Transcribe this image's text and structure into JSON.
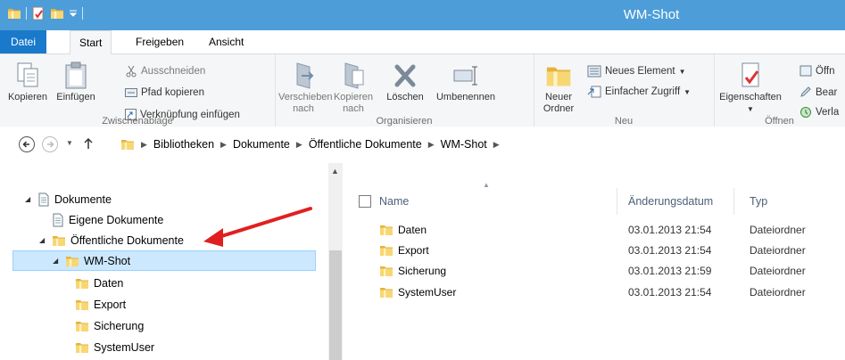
{
  "window": {
    "title": "WM-Shot"
  },
  "tabs": {
    "file": "Datei",
    "start": "Start",
    "share": "Freigeben",
    "view": "Ansicht"
  },
  "ribbon": {
    "clipboard": {
      "label": "Zwischenablage",
      "copy": "Kopieren",
      "paste": "Einfügen",
      "cut": "Ausschneiden",
      "copy_path": "Pfad kopieren",
      "paste_shortcut": "Verknüpfung einfügen"
    },
    "organize": {
      "label": "Organisieren",
      "move_to_line1": "Verschieben",
      "move_to_line2": "nach",
      "copy_to_line1": "Kopieren",
      "copy_to_line2": "nach",
      "delete": "Löschen",
      "rename": "Umbenennen"
    },
    "new": {
      "label": "Neu",
      "new_folder_line1": "Neuer",
      "new_folder_line2": "Ordner",
      "new_item": "Neues Element",
      "easy_access": "Einfacher Zugriff"
    },
    "open": {
      "label": "Öffnen",
      "properties": "Eigenschaften",
      "open": "Öffn",
      "edit": "Bear",
      "history": "Verla"
    }
  },
  "address": {
    "crumbs": [
      "Bibliotheken",
      "Dokumente",
      "Öffentliche Dokumente",
      "WM-Shot"
    ]
  },
  "nav_tree": {
    "items": [
      {
        "label": "Dokumente"
      },
      {
        "label": "Eigene Dokumente"
      },
      {
        "label": "Öffentliche Dokumente"
      },
      {
        "label": "WM-Shot"
      },
      {
        "label": "Daten"
      },
      {
        "label": "Export"
      },
      {
        "label": "Sicherung"
      },
      {
        "label": "SystemUser"
      }
    ]
  },
  "file_list": {
    "columns": {
      "name": "Name",
      "date": "Änderungsdatum",
      "type": "Typ"
    },
    "rows": [
      {
        "name": "Daten",
        "date": "03.01.2013 21:54",
        "type": "Dateiordner"
      },
      {
        "name": "Export",
        "date": "03.01.2013 21:54",
        "type": "Dateiordner"
      },
      {
        "name": "Sicherung",
        "date": "03.01.2013 21:59",
        "type": "Dateiordner"
      },
      {
        "name": "SystemUser",
        "date": "03.01.2013 21:54",
        "type": "Dateiordner"
      }
    ]
  },
  "colors": {
    "titlebar": "#4d9dd9",
    "file_tab": "#1979ca",
    "selection": "#cce8ff",
    "annotation_arrow": "#e02020",
    "folder": "#f2c94c"
  }
}
